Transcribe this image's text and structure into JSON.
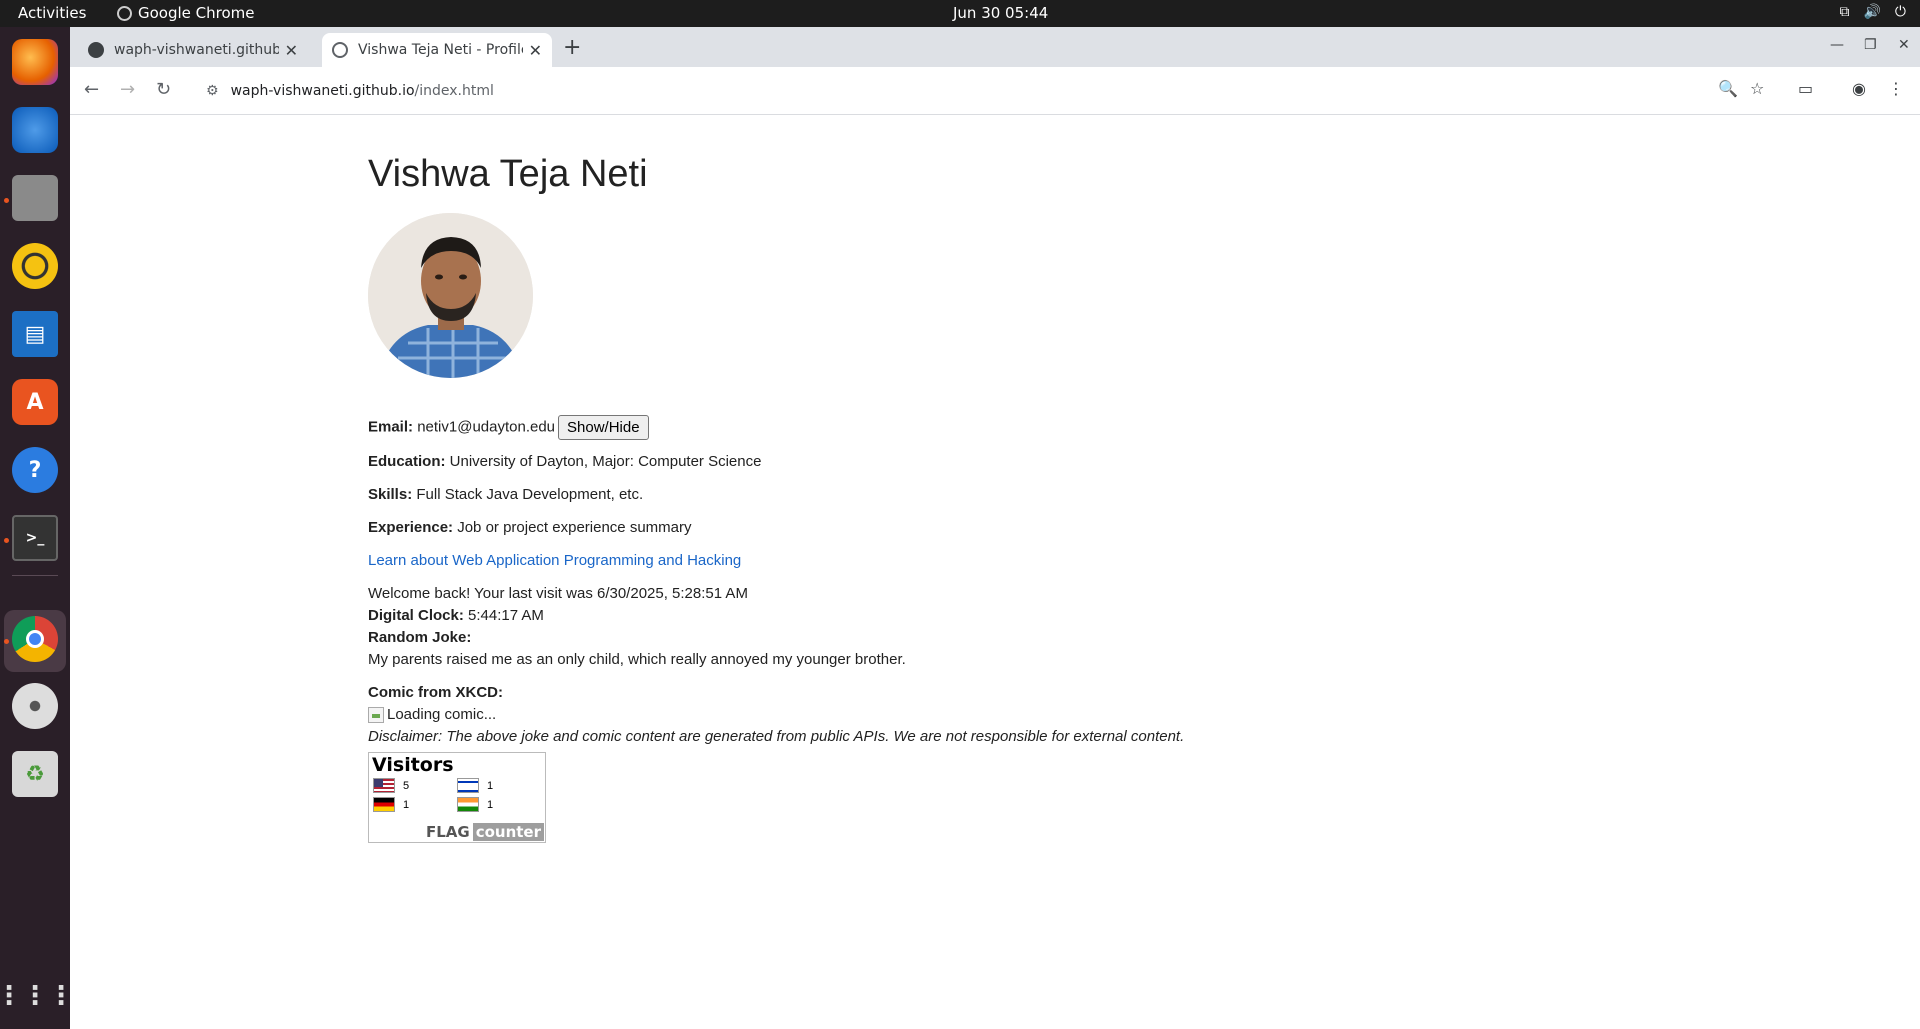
{
  "topbar": {
    "activities": "Activities",
    "app_name": "Google Chrome",
    "datetime": "Jun 30  05:44"
  },
  "dock": {
    "items": [
      "Firefox",
      "Thunderbird",
      "Files",
      "Rhythmbox",
      "LibreOffice Writer",
      "Ubuntu Software",
      "Help",
      "Terminal",
      "Google Chrome",
      "Disc",
      "Trash",
      "Show Applications"
    ]
  },
  "browser": {
    "tabs": [
      {
        "title": "waph-vishwaneti.github.io",
        "active": false
      },
      {
        "title": "Vishwa Teja Neti - Profile",
        "active": true
      }
    ],
    "url_host": "waph-vishwaneti.github.io",
    "url_path": "/index.html"
  },
  "profile": {
    "name": "Vishwa Teja Neti",
    "email_label": "Email:",
    "email": "netiv1@udayton.edu",
    "toggle_button": "Show/Hide",
    "education_label": "Education:",
    "education": "University of Dayton, Major: Computer Science",
    "skills_label": "Skills:",
    "skills": "Full Stack Java Development, etc.",
    "experience_label": "Experience:",
    "experience": "Job or project experience summary",
    "course_link": "Learn about Web Application Programming and Hacking",
    "welcome": "Welcome back! Your last visit was 6/30/2025, 5:28:51 AM",
    "clock_label": "Digital Clock:",
    "clock": "5:44:17 AM",
    "joke_label": "Random Joke:",
    "joke": "My parents raised me as an only child, which really annoyed my younger brother.",
    "comic_label": "Comic from XKCD:",
    "comic_alt": "Loading comic...",
    "disclaimer": "Disclaimer: The above joke and comic content are generated from public APIs. We are not responsible for external content."
  },
  "flag_counter": {
    "title": "Visitors",
    "entries": [
      {
        "country": "US",
        "count": "5"
      },
      {
        "country": "IL",
        "count": "1"
      },
      {
        "country": "DE",
        "count": "1"
      },
      {
        "country": "IN",
        "count": "1"
      }
    ],
    "brand_left": "FLAG",
    "brand_right": "counter"
  }
}
